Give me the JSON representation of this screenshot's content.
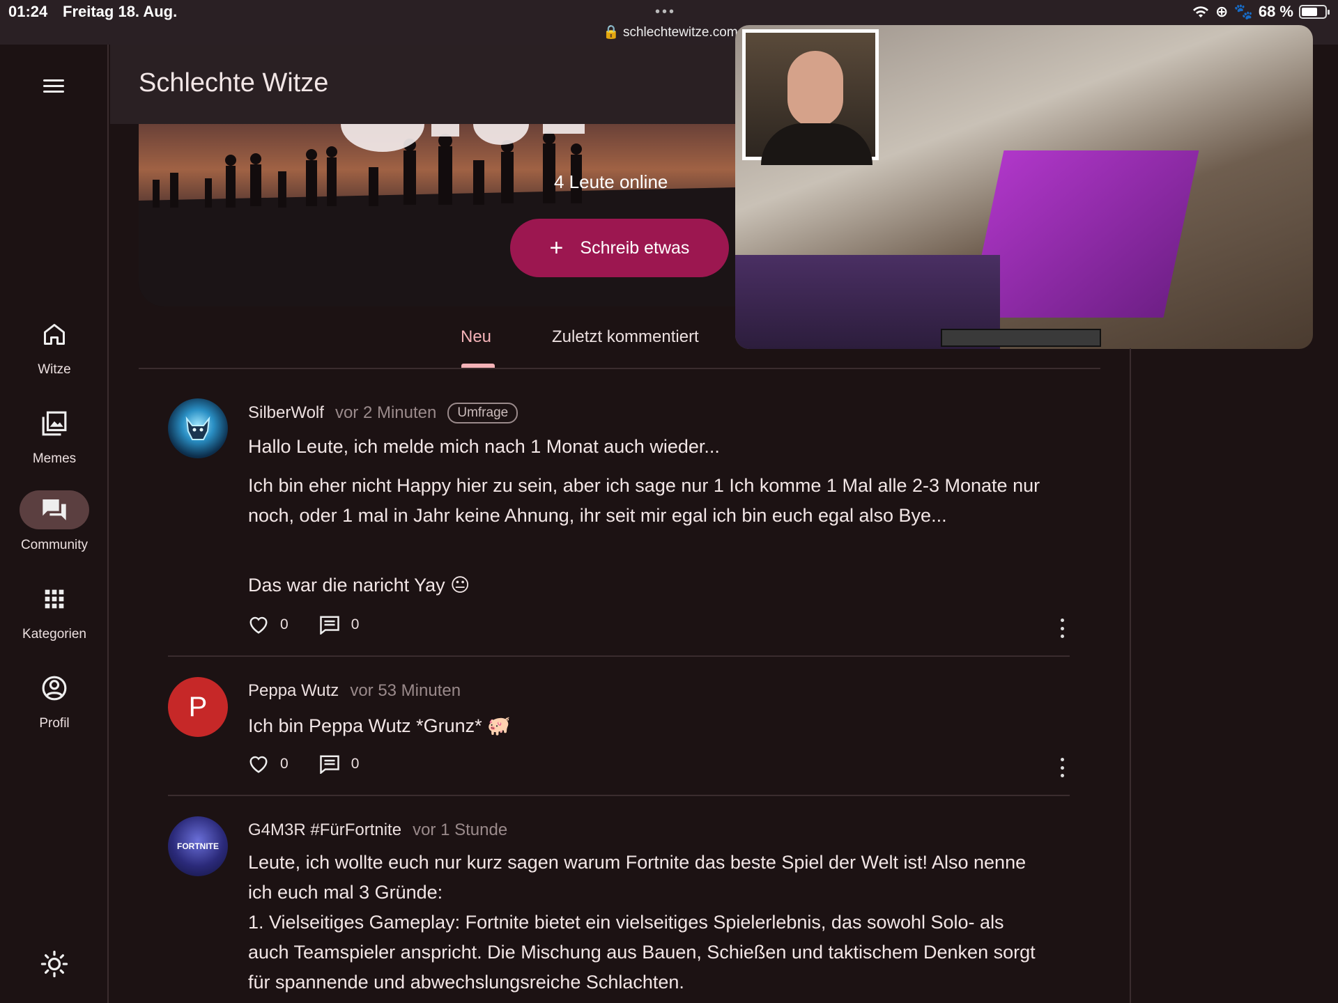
{
  "status_bar": {
    "time": "01:24",
    "date": "Freitag 18. Aug.",
    "dots": "•••",
    "url": "schlechtewitze.com",
    "battery": "68 %",
    "battery_level": 0.68
  },
  "app": {
    "title": "Schlechte Witze"
  },
  "nav": {
    "items": [
      {
        "label": "Witze",
        "icon": "home-icon"
      },
      {
        "label": "Memes",
        "icon": "gallery-icon"
      },
      {
        "label": "Community",
        "icon": "forum-icon",
        "active": true
      },
      {
        "label": "Kategorien",
        "icon": "apps-grid-icon"
      },
      {
        "label": "Profil",
        "icon": "account-circle-icon"
      }
    ]
  },
  "hero": {
    "online": "4 Leute online",
    "write_button": "Schreib etwas"
  },
  "tabs": [
    {
      "label": "Neu",
      "active": true
    },
    {
      "label": "Zuletzt kommentiert"
    }
  ],
  "posts": [
    {
      "author": "SilberWolf",
      "time": "vor 2 Minuten",
      "badge": "Umfrage",
      "title": "Hallo Leute, ich melde mich nach 1 Monat auch wieder...",
      "body": "Ich bin eher nicht Happy hier zu sein, aber ich sage nur 1 Ich komme 1 Mal alle 2-3 Monate nur noch, oder 1 mal in Jahr keine Ahnung, ihr seit mir egal ich bin euch egal also Bye...",
      "extra": "Das war die naricht Yay 😐",
      "likes": "0",
      "comments": "0"
    },
    {
      "author": "Peppa Wutz",
      "time": "vor 53 Minuten",
      "avatar_letter": "P",
      "title": "Ich bin Peppa Wutz *Grunz* 🐖",
      "likes": "0",
      "comments": "0"
    },
    {
      "author": "G4M3R #FürFortnite",
      "time": "vor 1 Stunde",
      "avatar_text": "FORTNITE",
      "title": "Leute, ich wollte euch nur kurz sagen warum Fortnite das beste Spiel der Welt ist! Also nenne ich euch mal 3 Gründe:",
      "body": "1. Vielseitiges Gameplay: Fortnite bietet ein vielseitiges Spielerlebnis, das sowohl Solo- als auch Teamspieler anspricht. Die Mischung aus Bauen, Schießen und taktischem Denken sorgt für spannende und abwechslungsreiche Schlachten."
    }
  ],
  "colors": {
    "background": "#1c1213",
    "accent": "#f4b3b8",
    "button": "#9c1750",
    "avatar_red": "#c62828"
  }
}
